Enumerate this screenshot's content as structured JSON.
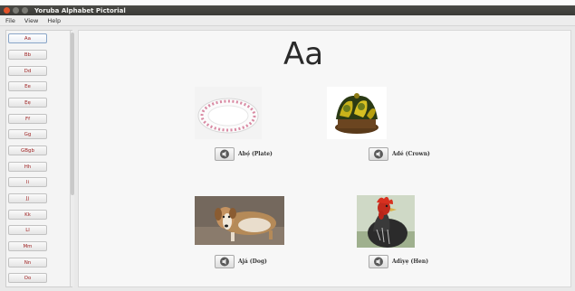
{
  "window": {
    "title": "Yoruba Alphabet Pictorial"
  },
  "menu": {
    "items": [
      "File",
      "View",
      "Help"
    ]
  },
  "sidebar": {
    "letters": [
      "Aa",
      "Bb",
      "Dd",
      "Ee",
      "Ẹẹ",
      "Ff",
      "Gg",
      "GBgb",
      "Hh",
      "Ii",
      "Jj",
      "Kk",
      "Ll",
      "Mm",
      "Nn",
      "Oo"
    ],
    "selected": "Aa"
  },
  "main": {
    "letter": "Aa",
    "cards": [
      {
        "label": "Abọ́ (Plate)",
        "icon": "plate-image"
      },
      {
        "label": "Adé (Crown)",
        "icon": "crown-image"
      },
      {
        "label": "Ajá (Dog)",
        "icon": "dog-image"
      },
      {
        "label": "Adìyẹ (Hen)",
        "icon": "hen-image"
      }
    ]
  }
}
